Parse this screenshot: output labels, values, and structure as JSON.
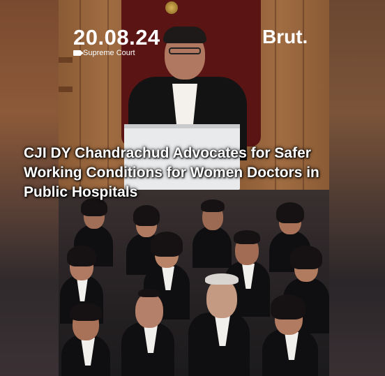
{
  "video": {
    "date": "20.08.24",
    "source_label": "Supreme Court",
    "brand": "Brut."
  },
  "headline": "CJI DY Chandrachud Advocates for Safer\nWorking Conditions for Women Doctors in\nPublic Hospitals"
}
